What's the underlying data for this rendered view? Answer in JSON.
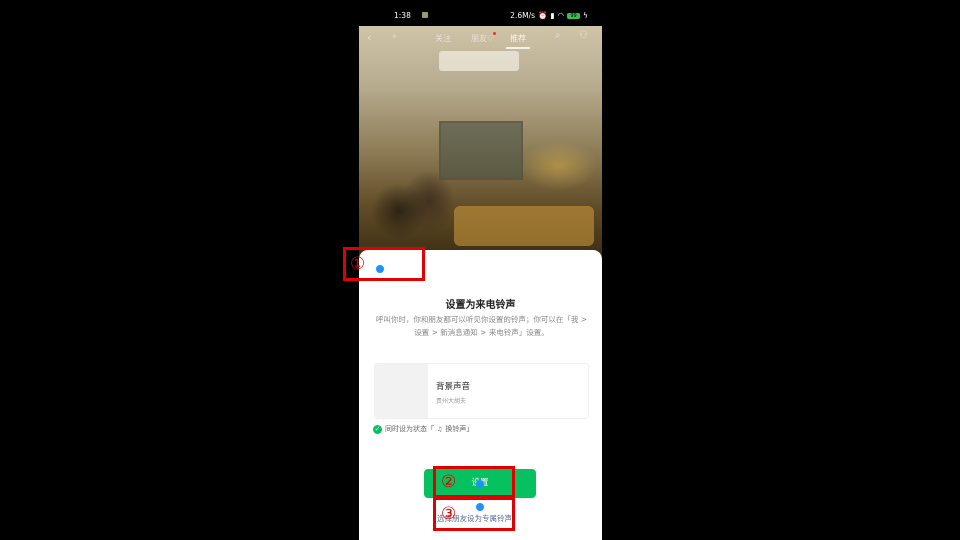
{
  "status_bar": {
    "time": "1:38",
    "net_speed": "2.6M/s",
    "battery": "99"
  },
  "top_nav": {
    "back_icon": "chevron-left-icon",
    "tabs": [
      "关注",
      "朋友♡",
      "推荐"
    ],
    "active_tab": "推荐"
  },
  "sheet": {
    "title": "设置为来电铃声",
    "description": "呼叫你时，你和朋友都可以听见你设置的铃声；你可以在「我 > 设置 > 新消息通知 > 来电铃声」设置。",
    "music": {
      "name": "背景声音",
      "artist": "贵州大胡夫"
    },
    "status_option": "同时设为状态「",
    "status_option_suffix": "换铃声」",
    "confirm_button": "设置",
    "friend_link": "选择朋友设为专属铃声"
  },
  "annotations": {
    "label_1": "①",
    "label_2": "②",
    "label_3": "③",
    "color": "#e00000",
    "dot_color": "#1e90ff"
  }
}
